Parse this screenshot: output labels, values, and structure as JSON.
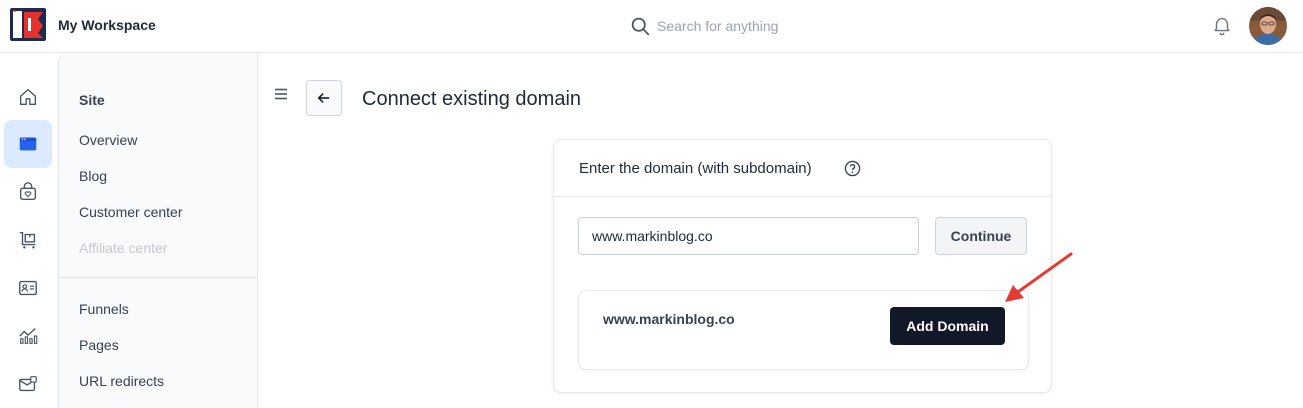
{
  "topbar": {
    "workspace_name": "My Workspace",
    "search_placeholder": "Search for anything"
  },
  "rail": {
    "items": [
      {
        "icon": "home-icon",
        "active": false
      },
      {
        "icon": "browser-window-icon",
        "active": true
      },
      {
        "icon": "store-bag-icon",
        "active": false
      },
      {
        "icon": "cart-icon",
        "active": false
      },
      {
        "icon": "contact-card-icon",
        "active": false
      },
      {
        "icon": "analytics-icon",
        "active": false
      },
      {
        "icon": "mail-icon",
        "active": false
      }
    ]
  },
  "sidebar": {
    "heading": "Site",
    "group1": [
      "Overview",
      "Blog",
      "Customer center",
      "Affiliate center"
    ],
    "group2": [
      "Funnels",
      "Pages",
      "URL redirects"
    ]
  },
  "main": {
    "title": "Connect existing domain",
    "card": {
      "title": "Enter the domain (with subdomain)",
      "input_value": "www.markinblog.co",
      "continue_label": "Continue",
      "result_domain": "www.markinblog.co",
      "add_label": "Add Domain"
    }
  },
  "colors": {
    "accent_bg": "#dbeafe",
    "accent_icon": "#2563eb",
    "primary_button": "#111827",
    "annotation_arrow": "#e53935"
  }
}
